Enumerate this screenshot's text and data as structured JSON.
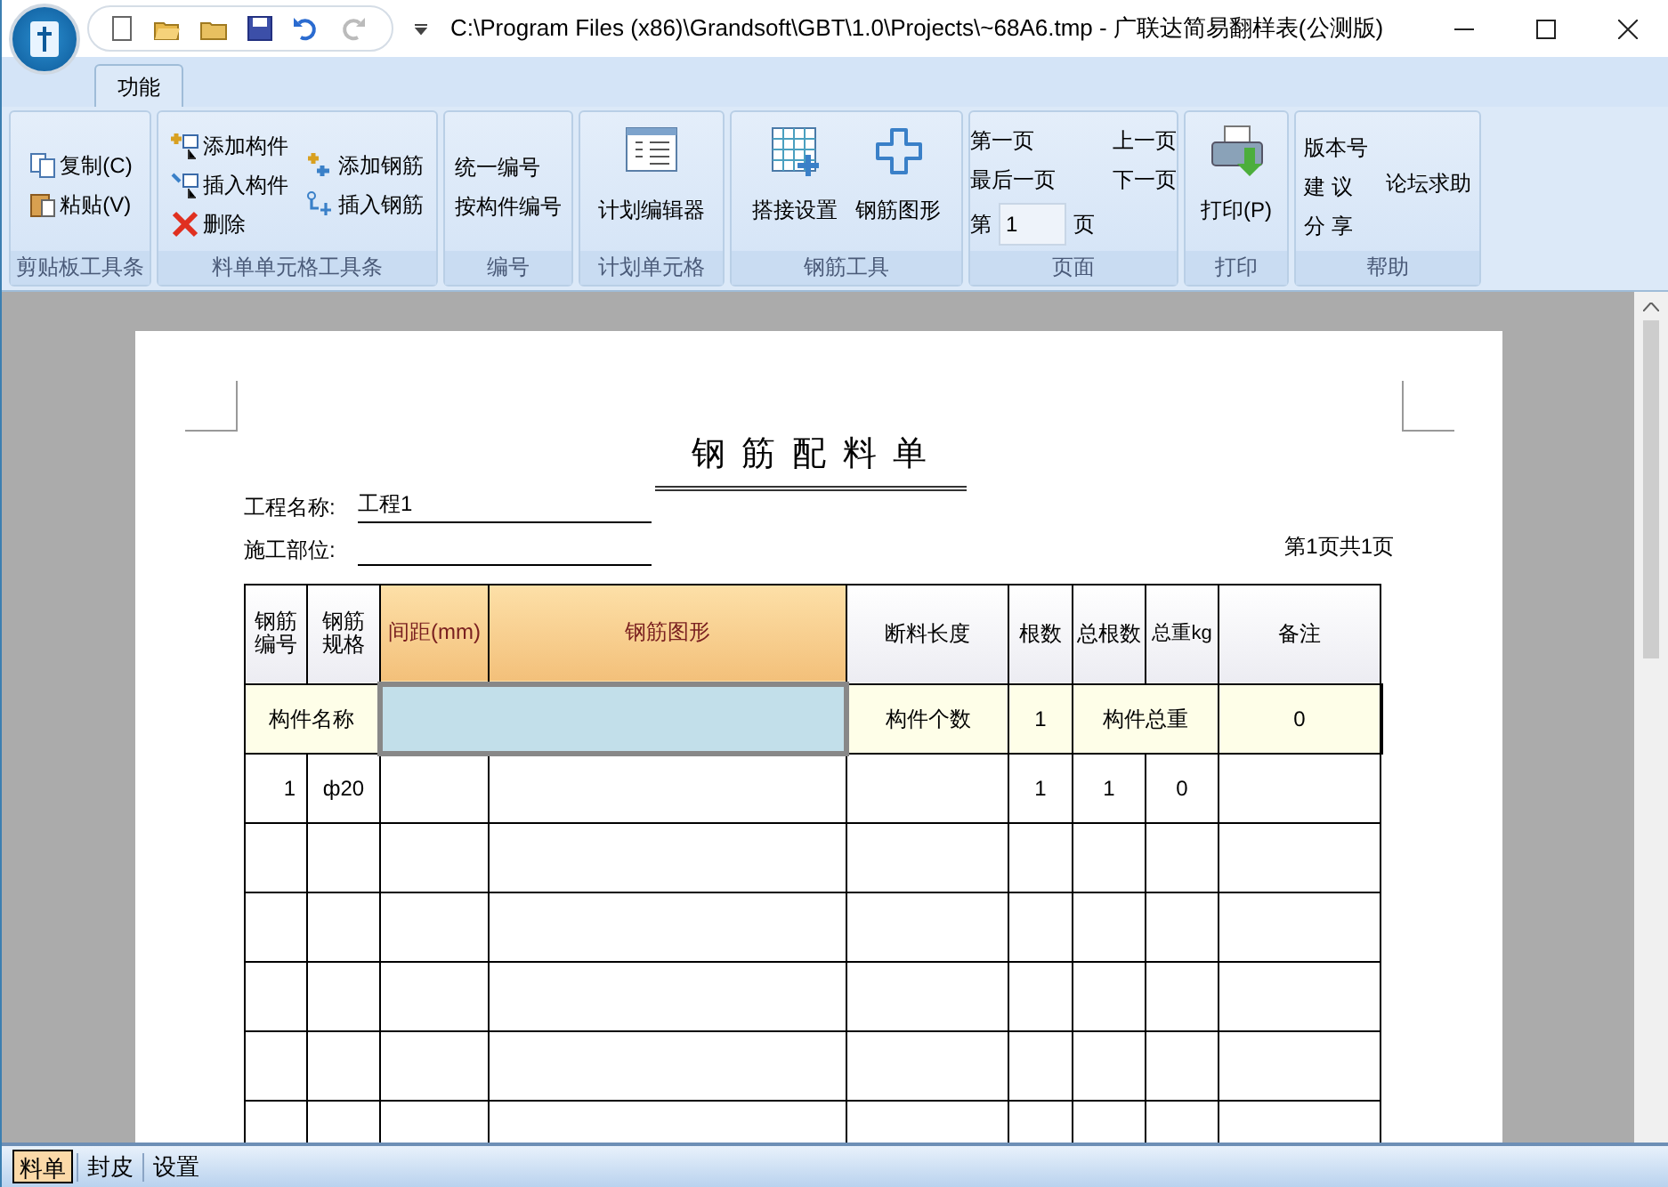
{
  "window": {
    "title": "C:\\Program Files (x86)\\Grandsoft\\GBT\\1.0\\Projects\\~68A6.tmp - 广联达简易翻样表(公测版)"
  },
  "ribbon": {
    "tabs": [
      {
        "label": "功能",
        "selected": true
      }
    ],
    "groups": [
      {
        "label": "剪贴板工具条",
        "columns": [
          [
            {
              "label": "复制(C)",
              "kind": "small"
            },
            {
              "label": "粘贴(V)",
              "kind": "small"
            }
          ]
        ]
      },
      {
        "label": "料单单元格工具条",
        "columns": [
          [
            {
              "label": "添加构件",
              "kind": "small"
            },
            {
              "label": "插入构件",
              "kind": "small"
            },
            {
              "label": "删除",
              "kind": "small"
            }
          ],
          [
            {
              "label": "添加钢筋",
              "kind": "small"
            },
            {
              "label": "插入钢筋",
              "kind": "small"
            }
          ]
        ]
      },
      {
        "label": "编号",
        "columns": [
          [
            {
              "label": "统一编号",
              "kind": "text"
            },
            {
              "label": "按构件编号",
              "kind": "text"
            }
          ]
        ]
      },
      {
        "label": "计划单元格",
        "columns": [
          [
            {
              "label": "计划编辑器",
              "kind": "large"
            }
          ]
        ]
      },
      {
        "label": "钢筋工具",
        "columns": [
          [
            {
              "label": "搭接设置",
              "kind": "large"
            }
          ],
          [
            {
              "label": "钢筋图形",
              "kind": "large"
            }
          ]
        ]
      },
      {
        "label": "页面",
        "columns": [
          [
            {
              "label": "第一页",
              "kind": "text"
            },
            {
              "label": "最后一页",
              "kind": "text"
            },
            {
              "kind": "page_input",
              "prefix": "第",
              "value": "1",
              "suffix": "页"
            }
          ],
          [
            {
              "label": "上一页",
              "kind": "text"
            },
            {
              "label": "下一页",
              "kind": "text"
            }
          ]
        ]
      },
      {
        "label": "打印",
        "columns": [
          [
            {
              "label": "打印(P)",
              "kind": "large"
            }
          ]
        ]
      },
      {
        "label": "帮助",
        "columns": [
          [
            {
              "label": "版本号",
              "kind": "text"
            },
            {
              "label": "建 议",
              "kind": "text"
            },
            {
              "label": "分 享",
              "kind": "text"
            }
          ],
          [
            {
              "label": "论坛求助",
              "kind": "text"
            }
          ]
        ]
      }
    ]
  },
  "document": {
    "title": "钢 筋 配 料 单",
    "fields": [
      {
        "label": "工程名称:",
        "value": "工程1"
      },
      {
        "label": "施工部位:"
      }
    ],
    "page_info": "第1页共1页",
    "table": {
      "columns": [
        {
          "label": "钢筋编号",
          "highlighted": false
        },
        {
          "label": "钢筋规格",
          "highlighted": false
        },
        {
          "label": "间距(mm)",
          "highlighted": true
        },
        {
          "label": "钢筋图形",
          "highlighted": true
        },
        {
          "label": "断料长度",
          "highlighted": false
        },
        {
          "label": "根数",
          "highlighted": false
        },
        {
          "label": "总根数",
          "highlighted": false
        },
        {
          "label": "总重kg",
          "highlighted": false
        },
        {
          "label": "备注",
          "highlighted": false
        }
      ],
      "summary_row": [
        {
          "text": "构件名称",
          "selected": false
        },
        {
          "selected": true
        },
        {
          "text": "构件个数",
          "selected": false
        },
        {
          "text": "1",
          "selected": false
        },
        {
          "text": "构件总重",
          "selected": false
        },
        {
          "text": "0",
          "selected": false
        }
      ],
      "rows": [
        {
          "number": "1",
          "spec": "ф20",
          "count": "1",
          "total_count": "1",
          "total_weight": "0"
        }
      ]
    }
  },
  "sheet_tabs": [
    {
      "label": "料单",
      "selected": true
    },
    {
      "label": "封皮",
      "selected": false
    },
    {
      "label": "设置",
      "selected": false
    }
  ]
}
